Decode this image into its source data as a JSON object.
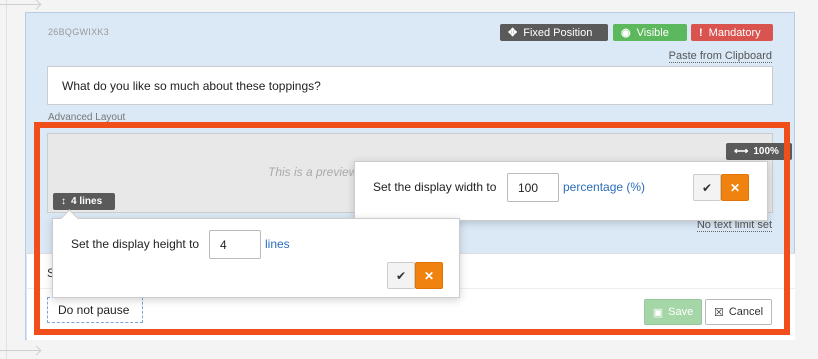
{
  "question": {
    "id_code": "26BQGWIXK3",
    "text": "What do you like so much about these toppings?"
  },
  "badges": {
    "fixed_position": "Fixed Position",
    "visible": "Visible",
    "mandatory": "Mandatory"
  },
  "links": {
    "paste_from_clipboard": "Paste from Clipboard",
    "no_text_limit": "No text limit set"
  },
  "advanced_layout_label": "Advanced Layout",
  "preview": {
    "text": "This is a preview",
    "width_chip": "100%",
    "lines_chip": "4 lines"
  },
  "width_popover": {
    "label": "Set the display width to",
    "value": "100",
    "unit": "percentage (%)"
  },
  "height_popover": {
    "label": "Set the display height to",
    "value": "4",
    "unit": "lines"
  },
  "lower": {
    "s_letter": "S",
    "pause_option": "Do not pause",
    "save_label": "Save",
    "cancel_label": "Cancel"
  },
  "icons": {
    "move": "move-icon",
    "eye": "eye-icon",
    "exclamation": "exclamation-icon",
    "resize_horizontal": "resize-horizontal-icon",
    "resize_vertical": "resize-vertical-icon",
    "check": "check-icon",
    "close": "close-icon",
    "save": "save-icon",
    "cancel": "cancel-icon"
  },
  "colors": {
    "highlight": "#f04e1a",
    "card_bg": "#dbe9f7",
    "visible_badge": "#5cb85c",
    "mandatory_badge": "#d9534f",
    "dark_badge": "#5a5a5a",
    "cancel_orange": "#f0820f",
    "link_blue": "#2a6ebb",
    "save_green": "#a5d6a7"
  }
}
